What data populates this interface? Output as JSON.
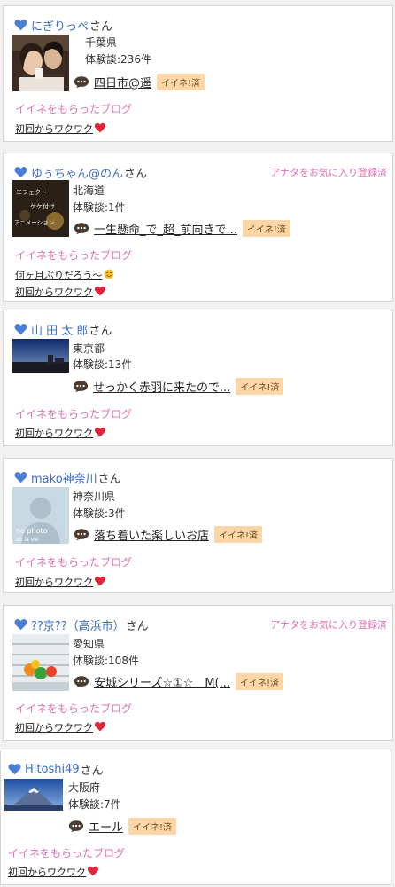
{
  "suffix": "さん",
  "like_done": "イイネ!済",
  "liked_blog_heading": "イイネをもらったブログ",
  "fav_label": "アナタをお気に入り登録済",
  "colors": {
    "user_link": "#3a6cc4",
    "pink": "#e06fb3",
    "badge_bg": "#fcd6a6",
    "heart_red": "#e0263a"
  },
  "users": [
    {
      "name": "にぎりっぺ",
      "favorited": false,
      "prefecture": "千葉県",
      "experience": "体験談:236件",
      "story": "四日市@遥",
      "blog": "初回からワクワク",
      "blog_emoji": "red-heart-icon"
    },
    {
      "name": "ゆぅちゃん@のん",
      "favorited": true,
      "prefecture": "北海道",
      "experience": "体験談:1件",
      "story": "一生懸命_で_超_前向きで...",
      "blog": "何ヶ月ぶりだろう〜",
      "blog_emoji": "smiling-face-icon",
      "blog2": "初回からワクワク",
      "thumb_lines": [
        "エフェクト",
        "ケケ付け",
        "アニメーション"
      ]
    },
    {
      "name": "山 田 太 郎",
      "favorited": false,
      "prefecture": "東京都",
      "experience": "体験談:13件",
      "story": "せっかく赤羽に来たので...",
      "blog": "初回からワクワク",
      "blog_emoji": "red-heart-icon"
    },
    {
      "name": "mako神奈川",
      "favorited": false,
      "prefecture": "神奈川県",
      "experience": "体験談:3件",
      "story": "落ち着いた楽しいお店",
      "blog": "初回からワクワク",
      "blog_emoji": "red-heart-icon",
      "thumb_lines": [
        "no photo",
        "oh la vie"
      ]
    },
    {
      "name": "??京??（高浜市）",
      "favorited": true,
      "prefecture": "愛知県",
      "experience": "体験談:108件",
      "story": "安城シリーズ☆①☆　M(...",
      "blog": "初回からワクワク",
      "blog_emoji": "red-heart-icon"
    },
    {
      "name": "Hitoshi49",
      "favorited": false,
      "prefecture": "大阪府",
      "experience": "体験談:7件",
      "story": "エール",
      "blog": "初回からワクワク",
      "blog_emoji": "red-heart-icon"
    }
  ]
}
